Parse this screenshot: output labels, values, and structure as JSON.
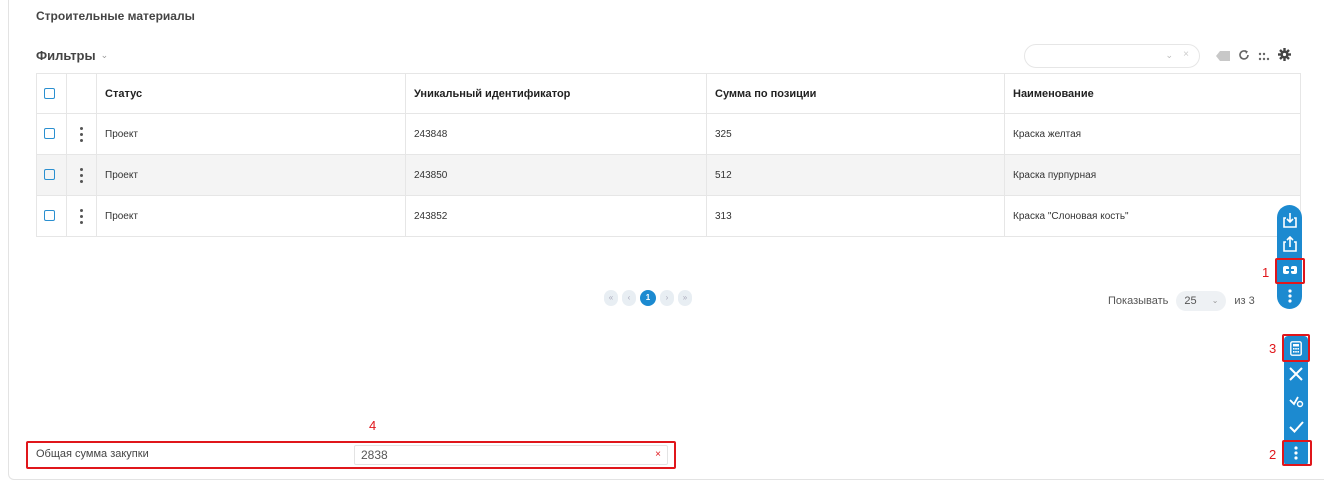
{
  "page": {
    "title": "Строительные материалы"
  },
  "filters": {
    "label": "Фильтры"
  },
  "toolbar": {
    "icons": [
      "eraser-icon",
      "refresh-icon",
      "columns-icon",
      "gear-icon"
    ]
  },
  "table": {
    "columns": [
      "Статус",
      "Уникальный идентификатор",
      "Сумма по позиции",
      "Наименование"
    ],
    "rows": [
      {
        "status": "Проект",
        "id": "243848",
        "sum": "325",
        "name": "Краска желтая"
      },
      {
        "status": "Проект",
        "id": "243850",
        "sum": "512",
        "name": "Краска пурпурная"
      },
      {
        "status": "Проект",
        "id": "243852",
        "sum": "313",
        "name": "Краска \"Слоновая кость\""
      }
    ]
  },
  "pagination": {
    "first": "«",
    "prev": "‹",
    "current": "1",
    "next": "›",
    "last": "»",
    "show_label": "Показывать",
    "page_size": "25",
    "total_label": "из 3"
  },
  "total": {
    "label": "Общая сумма закупки",
    "value": "2838",
    "clear": "×"
  },
  "annotations": {
    "n1": "1",
    "n2": "2",
    "n3": "3",
    "n4": "4"
  },
  "colors": {
    "accent": "#1c8ad0",
    "highlight": "#e0161b"
  }
}
